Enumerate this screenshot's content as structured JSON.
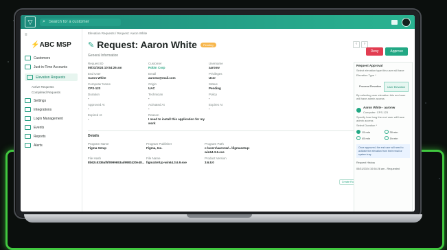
{
  "app": {
    "search_placeholder": "Search for a customer"
  },
  "sidebar": {
    "company": "ABC MSP",
    "items": [
      {
        "label": "Customers"
      },
      {
        "label": "Just-in-Time Accounts"
      },
      {
        "label": "Elevation Requests"
      },
      {
        "label": "Active Requests"
      },
      {
        "label": "Completed Requests"
      },
      {
        "label": "Settings"
      },
      {
        "label": "Integrations"
      },
      {
        "label": "Login Management"
      },
      {
        "label": "Events"
      },
      {
        "label": "Reports"
      },
      {
        "label": "Alerts"
      }
    ]
  },
  "breadcrumb": "Elevation Requests / Request: Aaron White",
  "title": "Request: Aaron White",
  "status": "Pending",
  "actions": {
    "deny": "Deny",
    "approve": "Approve"
  },
  "general": {
    "label": "General Information",
    "fields": [
      {
        "label": "Request ID",
        "value": "05/31/2024 10:54:26 am"
      },
      {
        "label": "Customer",
        "value": "Robin Corp"
      },
      {
        "label": "Username",
        "value": "aaronw"
      },
      {
        "label": "End User",
        "value": "Aaron White"
      },
      {
        "label": "Email",
        "value": "aaronw@mail.com"
      },
      {
        "label": "Privileges",
        "value": "User"
      },
      {
        "label": "Computer Name",
        "value": "CPS-123"
      },
      {
        "label": "Origin",
        "value": "UAC"
      },
      {
        "label": "Status",
        "value": "Pending"
      },
      {
        "label": "Duration",
        "value": "-"
      },
      {
        "label": "Technician",
        "value": "-"
      },
      {
        "label": "Policy",
        "value": "-"
      },
      {
        "label": "Approved At",
        "value": "-"
      },
      {
        "label": "Activated At",
        "value": "-"
      },
      {
        "label": "Expires At",
        "value": "-"
      },
      {
        "label": "Expired At",
        "value": "-"
      },
      {
        "label": "Reason",
        "value": "I need to install this application for my work"
      },
      {
        "label": "",
        "value": ""
      }
    ]
  },
  "details": {
    "label": "Details",
    "create_rule": "Create Rule",
    "fields": [
      {
        "label": "Program Name",
        "value": "Figma Setup"
      },
      {
        "label": "Program Publisher",
        "value": "Figma, Inc."
      },
      {
        "label": "Program Path",
        "value": "c:\\users\\aaronw\\...\\figmasetup-win64.3.6.exe"
      },
      {
        "label": "File Hash",
        "value": "8b62c5336af5f0999653ad9983420e48..."
      },
      {
        "label": "File Name",
        "value": "figmaSetUp-win64.3.6.9.exe"
      },
      {
        "label": "Product Version",
        "value": "3.6.8.0"
      }
    ]
  },
  "approval": {
    "title": "Request Approval",
    "subtitle": "Select elevation type this user will have",
    "type_label": "Elevation Type *",
    "tabs": [
      "Process Elevation",
      "User Elevation"
    ],
    "description": "By selecting user elevation this end user will have admin access",
    "approver_name": "Aaron White - aaronw",
    "approver_sub": "Computer: CPS-123",
    "how_long": "Specify how long the end user will have admin access",
    "duration_label": "Select Duration *",
    "durations": [
      "15 min",
      "30 min",
      "45 min",
      "1h min"
    ],
    "info": "Once approved, the end user will need to activate the elevation from their email or system tray.",
    "history_label": "Request History",
    "history": "05/31/2024 10:54:26 am - Requested"
  }
}
